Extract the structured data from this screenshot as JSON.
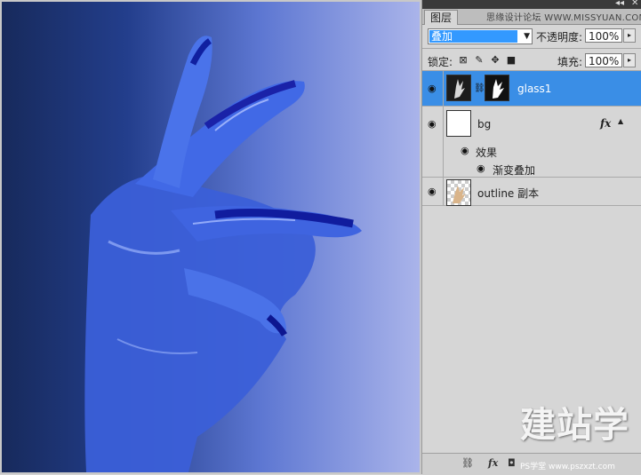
{
  "panel": {
    "tab_label": "图层",
    "watermark": "思缘设计论坛 WWW.MISSYUAN.COM",
    "blend_mode": "叠加",
    "opacity_label": "不透明度:",
    "opacity_value": "100%",
    "lock_label": "锁定:",
    "fill_label": "填充:",
    "fill_value": "100%"
  },
  "layers": [
    {
      "name": "glass1",
      "selected": true
    },
    {
      "name": "bg",
      "fx": "fx"
    },
    {
      "name": "效果"
    },
    {
      "name": "渐变叠加"
    },
    {
      "name": "outline 副本"
    }
  ],
  "footer": {
    "fx_label": "fx",
    "site_text": "PS学堂 www.pszxzt.com"
  },
  "brand": {
    "text": "建站学"
  },
  "colors": {
    "selection": "#3a8ee6",
    "gradient_dark": "#172a5c",
    "gradient_light": "#aab4ea"
  }
}
